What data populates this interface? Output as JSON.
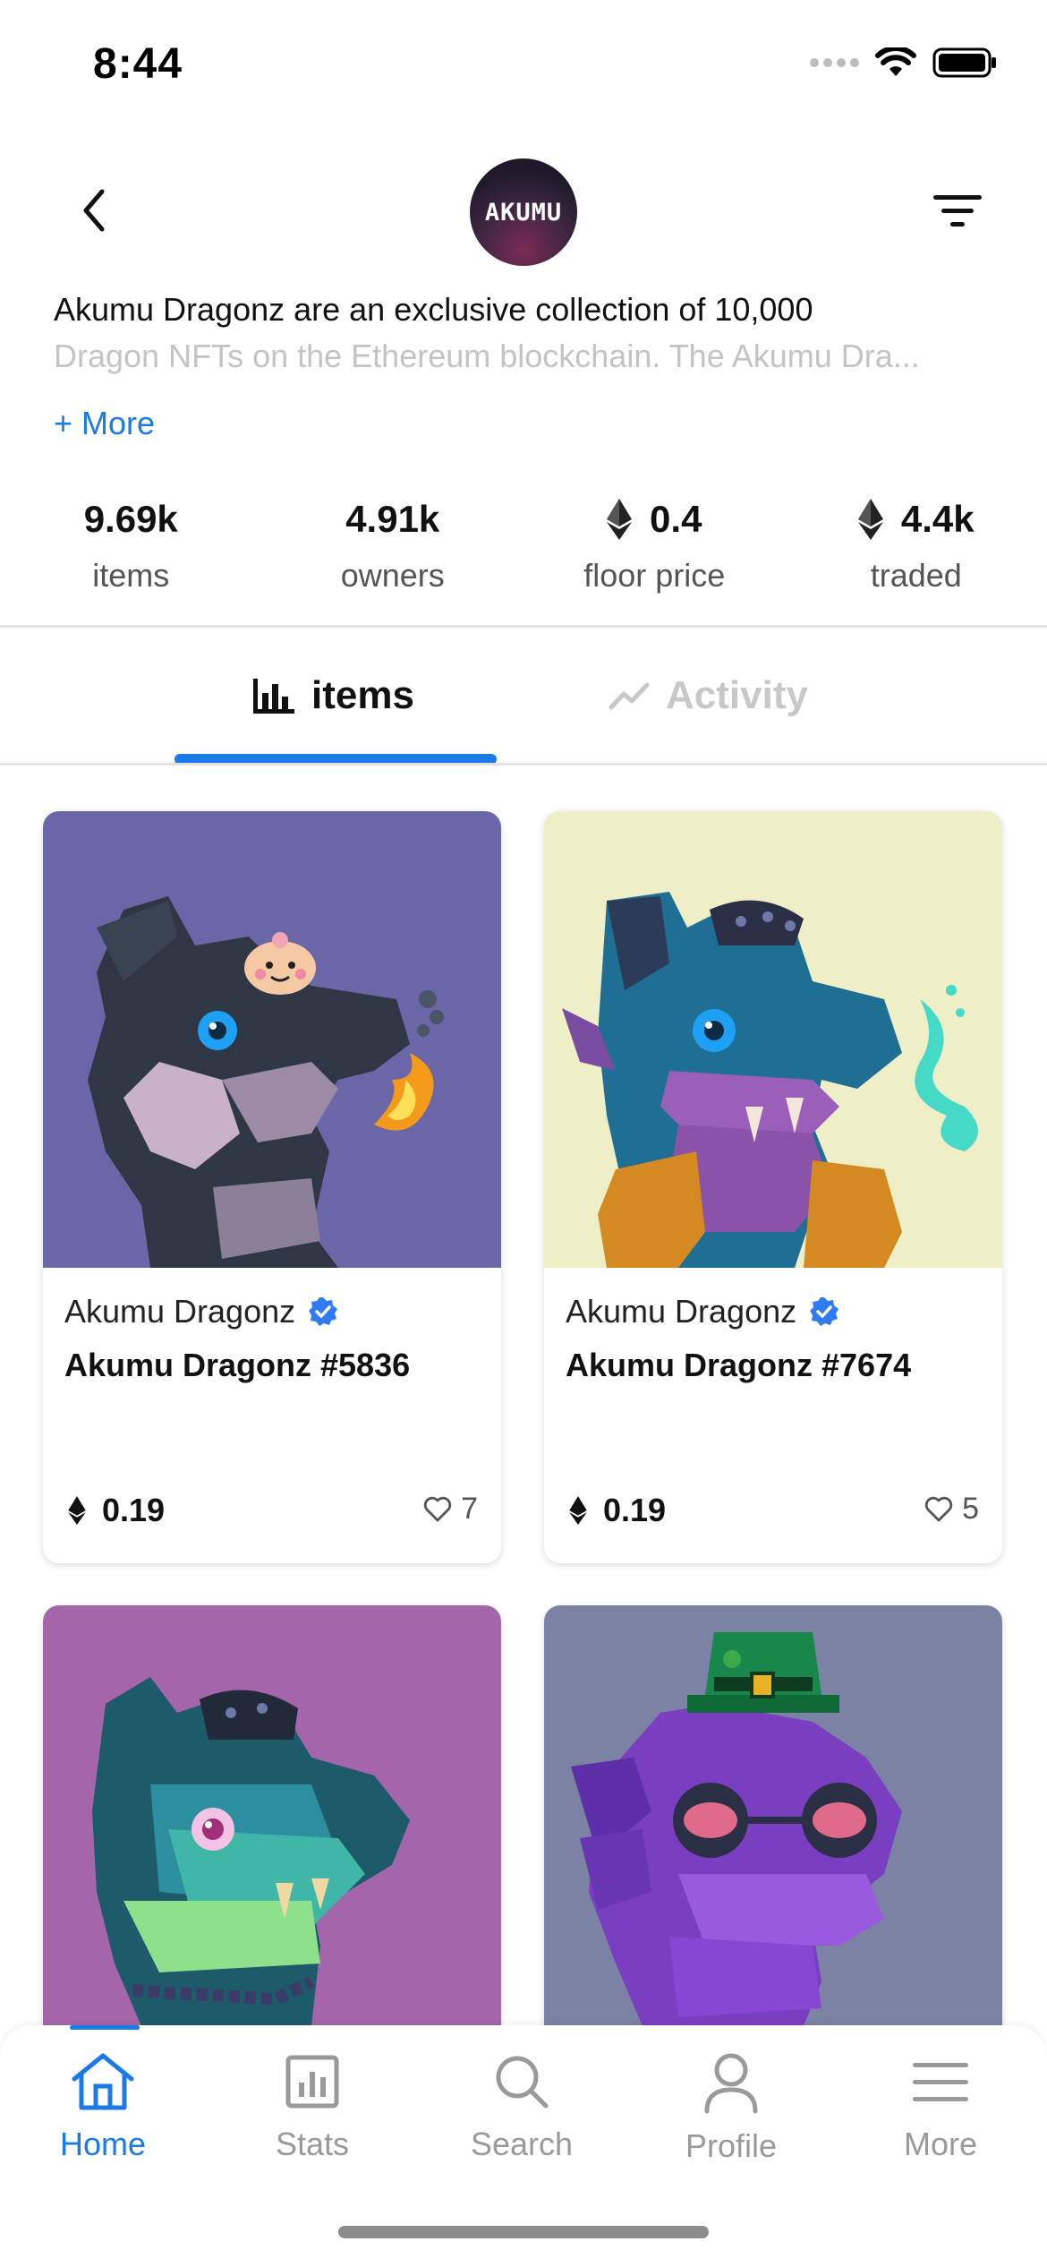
{
  "status_bar": {
    "time": "8:44"
  },
  "header": {
    "avatar_text": "AKUMU"
  },
  "description": {
    "line1": "Akumu Dragonz are an exclusive collection of 10,000",
    "line2": "Dragon NFTs on the Ethereum blockchain. The Akumu Dra...",
    "more_label": "+ More"
  },
  "stats": [
    {
      "value": "9.69k",
      "label": "items",
      "eth_icon": false
    },
    {
      "value": "4.91k",
      "label": "owners",
      "eth_icon": false
    },
    {
      "value": "0.4",
      "label": "floor price",
      "eth_icon": true
    },
    {
      "value": "4.4k",
      "label": "traded",
      "eth_icon": true
    }
  ],
  "tabs": [
    {
      "label": "items",
      "icon": "bar-chart-icon",
      "active": true
    },
    {
      "label": "Activity",
      "icon": "trend-line-icon",
      "active": false
    }
  ],
  "cards": [
    {
      "collection": "Akumu Dragonz",
      "title": "Akumu Dragonz #5836",
      "price": "0.19",
      "likes": "7",
      "bg": "#6a66a8"
    },
    {
      "collection": "Akumu Dragonz",
      "title": "Akumu Dragonz #7674",
      "price": "0.19",
      "likes": "5",
      "bg": "#eeefc6"
    },
    {
      "collection": "",
      "title": "",
      "price": "",
      "likes": "",
      "bg": "#a465ab"
    },
    {
      "collection": "",
      "title": "",
      "price": "",
      "likes": "",
      "bg": "#7b82a4"
    }
  ],
  "bottom_nav": [
    {
      "label": "Home",
      "icon": "home-icon",
      "active": true
    },
    {
      "label": "Stats",
      "icon": "stats-icon",
      "active": false
    },
    {
      "label": "Search",
      "icon": "search-icon",
      "active": false
    },
    {
      "label": "Profile",
      "icon": "profile-icon",
      "active": false
    },
    {
      "label": "More",
      "icon": "menu-icon",
      "active": false
    }
  ],
  "colors": {
    "accent": "#1a7be8",
    "verified": "#2f7cf6"
  }
}
